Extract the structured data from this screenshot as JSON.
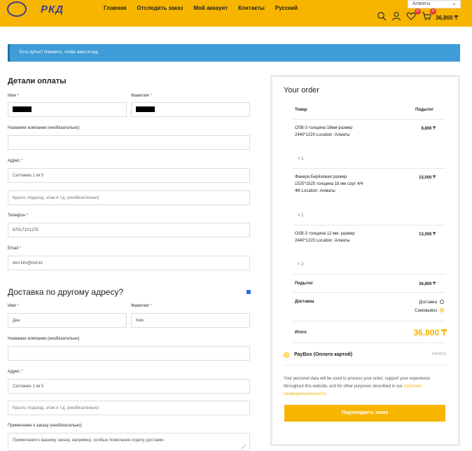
{
  "header": {
    "logo_text": "РКД",
    "nav": [
      "Главная",
      "Отследить заказ",
      "Мой аккаунт",
      "Контакты",
      "Русский"
    ],
    "city": "Алматы",
    "wishlist_count": "0",
    "cart_count": "6",
    "cart_total": "36,800 ₸"
  },
  "coupon": {
    "text": "Есть купон? Нажмите, чтобы ввести код"
  },
  "billing": {
    "title": "Детали оплаты",
    "first_name_label": "Имя",
    "last_name_label": "Фамилия",
    "company_label": "Название компании (необязательно)",
    "address_label": "Адрес",
    "address_value": "Сатпаева 1 кв 5",
    "address2_placeholder": "Крыло, подъезд, этаж и т.д. (необязательно)",
    "phone_label": "Телефон",
    "phone_value": "87017101275",
    "email_label": "Email",
    "email_value": "den.kim@rkd.kz",
    "required_mark": "*"
  },
  "shipping": {
    "title": "Доставка по другому адресу?",
    "first_name_label": "Имя",
    "first_name_value": "Ден",
    "last_name_label": "Фамилия",
    "last_name_value": "Ким",
    "company_label": "Название компании (необязательно)",
    "address_label": "Адрес",
    "address_value": "Сатпаева 1 кв 5",
    "address2_placeholder": "Крыло, подъезд, этаж и т.д. (необязательно)",
    "notes_label": "Примечание к заказу (необязательно)",
    "notes_placeholder": "Примечания к вашему заказу, например, особые пожелания отделу доставки."
  },
  "order": {
    "title": "Your order",
    "col_product": "Товар",
    "col_subtotal": "Подытог",
    "items": [
      {
        "name": "OSB-3 толщина 18мм размер 2440*1220 Location :Алматы",
        "qty": "× 1",
        "price": "8,800 ₸"
      },
      {
        "name": "Фанера Берёзовая размер 1525*1525 толщина 18 мм сорт 4/4 ФК Location :Алматы",
        "qty": "× 1",
        "price": "15,000 ₸"
      },
      {
        "name": "OSB-3 толщина 12 мм. размер 2440*1220 Location :Алматы",
        "qty": "× 2",
        "price": "13,000 ₸"
      }
    ],
    "subtotal_label": "Подытог",
    "subtotal_value": "36,800 ₸",
    "shipping_label": "Доставка",
    "shipping_options": [
      "Доставка",
      "Самовывоз"
    ],
    "total_label": "Итого",
    "total_value": "36,800 ₸",
    "payment_method": "PayBox (Оплата картой)",
    "payment_logo": "PAYBOX",
    "privacy_text": "Your personal data will be used to process your order, support your experience throughout this website, and for other purposes described in our",
    "privacy_link": "политика конфиденциальности",
    "submit_label": "Подтвердить заказ"
  }
}
